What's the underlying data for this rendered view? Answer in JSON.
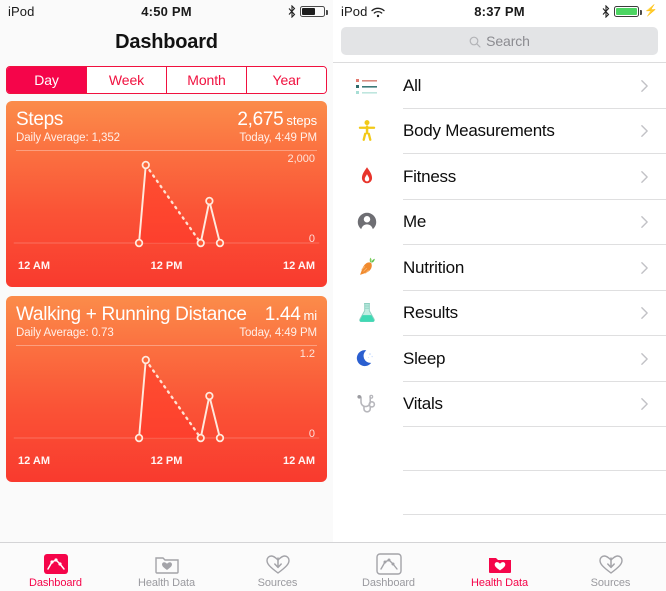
{
  "left": {
    "status": {
      "carrier": "iPod",
      "time": "4:50 PM",
      "bluetooth": "bluetooth-icon",
      "battery": "battery-icon"
    },
    "nav_title": "Dashboard",
    "segments": [
      {
        "label": "Day",
        "selected": true
      },
      {
        "label": "Week",
        "selected": false
      },
      {
        "label": "Month",
        "selected": false
      },
      {
        "label": "Year",
        "selected": false
      }
    ],
    "cards": [
      {
        "title": "Steps",
        "value": "2,675",
        "unit": "steps",
        "subtitle": "Daily Average: 1,352",
        "timestamp": "Today, 4:49 PM",
        "y_top": "2,000",
        "y_bottom": "0",
        "x_labels": [
          "12 AM",
          "12 PM",
          "12 AM"
        ]
      },
      {
        "title": "Walking + Running Distance",
        "value": "1.44",
        "unit": "mi",
        "subtitle": "Daily Average: 0.73",
        "timestamp": "Today, 4:49 PM",
        "y_top": "1.2",
        "y_bottom": "0",
        "x_labels": [
          "12 AM",
          "12 PM",
          "12 AM"
        ]
      }
    ],
    "tabs": [
      {
        "label": "Dashboard",
        "icon": "dashboard-chart-icon",
        "active": true
      },
      {
        "label": "Health Data",
        "icon": "folder-heart-icon",
        "active": false
      },
      {
        "label": "Sources",
        "icon": "heart-download-icon",
        "active": false
      }
    ]
  },
  "right": {
    "status": {
      "carrier": "iPod",
      "wifi": "wifi-icon",
      "time": "8:37 PM",
      "bluetooth": "bluetooth-icon",
      "battery": "battery-charging-icon"
    },
    "search": {
      "placeholder": "Search",
      "value": "",
      "icon": "search-icon"
    },
    "list": [
      {
        "label": "All",
        "icon": "list-lines-icon"
      },
      {
        "label": "Body Measurements",
        "icon": "body-figure-icon"
      },
      {
        "label": "Fitness",
        "icon": "flame-icon"
      },
      {
        "label": "Me",
        "icon": "person-head-icon"
      },
      {
        "label": "Nutrition",
        "icon": "carrot-icon"
      },
      {
        "label": "Results",
        "icon": "flask-icon"
      },
      {
        "label": "Sleep",
        "icon": "moon-icon"
      },
      {
        "label": "Vitals",
        "icon": "stethoscope-icon"
      }
    ],
    "tabs": [
      {
        "label": "Dashboard",
        "icon": "dashboard-chart-icon",
        "active": false
      },
      {
        "label": "Health Data",
        "icon": "folder-heart-icon",
        "active": true
      },
      {
        "label": "Sources",
        "icon": "heart-download-icon",
        "active": false
      }
    ]
  },
  "chart_data": [
    {
      "type": "line",
      "title": "Steps",
      "xlabel": "",
      "ylabel": "steps",
      "ylim": [
        0,
        2000
      ],
      "xlim": [
        "12 AM",
        "12 AM"
      ],
      "x_tick_labels": [
        "12 AM",
        "12 PM",
        "12 AM"
      ],
      "y_tick_labels": [
        "0",
        "2,000"
      ],
      "grid": false,
      "total_value": 2675,
      "daily_average": 1352,
      "series": [
        {
          "name": "Steps",
          "points": [
            {
              "x": 0.4,
              "y": 120
            },
            {
              "x": 0.44,
              "y": 1830
            },
            {
              "x": 0.62,
              "y": 55
            },
            {
              "x": 0.66,
              "y": 980
            },
            {
              "x": 0.72,
              "y": 55
            }
          ],
          "dashed_segment": [
            1,
            2
          ]
        }
      ]
    },
    {
      "type": "line",
      "title": "Walking + Running Distance",
      "xlabel": "",
      "ylabel": "mi",
      "ylim": [
        0,
        1.2
      ],
      "xlim": [
        "12 AM",
        "12 AM"
      ],
      "x_tick_labels": [
        "12 AM",
        "12 PM",
        "12 AM"
      ],
      "y_tick_labels": [
        "0",
        "1.2"
      ],
      "grid": false,
      "total_value": 1.44,
      "daily_average": 0.73,
      "series": [
        {
          "name": "Distance",
          "points": [
            {
              "x": 0.4,
              "y": 0.07
            },
            {
              "x": 0.44,
              "y": 1.09
            },
            {
              "x": 0.62,
              "y": 0.03
            },
            {
              "x": 0.66,
              "y": 0.58
            },
            {
              "x": 0.72,
              "y": 0.03
            }
          ],
          "dashed_segment": [
            1,
            2
          ]
        }
      ]
    }
  ]
}
